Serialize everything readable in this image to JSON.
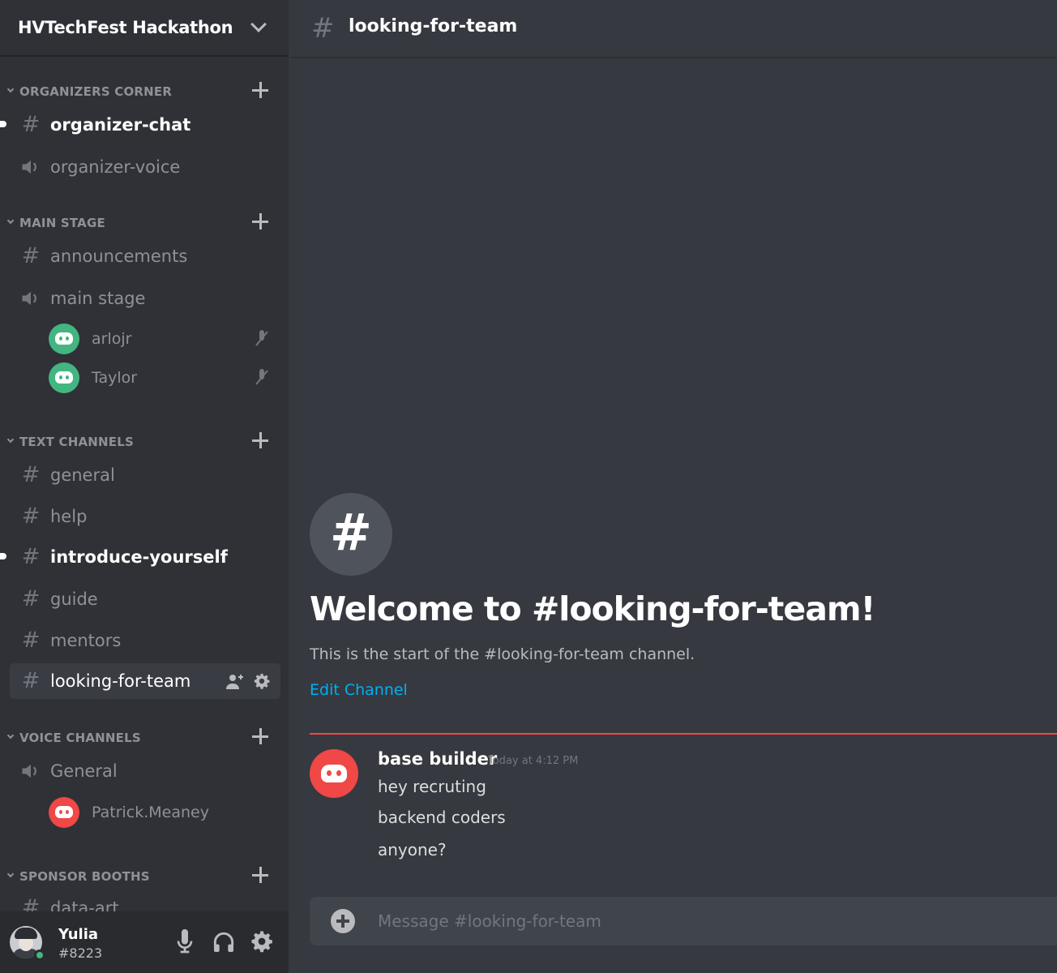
{
  "server": {
    "name": "HVTechFest Hackathon"
  },
  "categories": {
    "organizers": "ORGANIZERS CORNER",
    "main_stage": "MAIN STAGE",
    "text_channels": "TEXT CHANNELS",
    "voice_channels": "VOICE CHANNELS",
    "sponsor_booths": "SPONSOR BOOTHS"
  },
  "channels": {
    "organizer_chat": "organizer-chat",
    "organizer_voice": "organizer-voice",
    "announcements": "announcements",
    "main_stage": "main stage",
    "general": "general",
    "help": "help",
    "introduce_yourself": "introduce-yourself",
    "guide": "guide",
    "mentors": "mentors",
    "looking_for_team": "looking-for-team",
    "voice_general": "General",
    "data_art": "data-art"
  },
  "voice_users": {
    "main_stage": [
      "arlojr",
      "Taylor"
    ],
    "general": [
      "Patrick.Meaney"
    ]
  },
  "self": {
    "name": "Yulia",
    "tag": "#8223",
    "status": "online"
  },
  "header": {
    "channel": "looking-for-team"
  },
  "welcome": {
    "icon": "#",
    "title": "Welcome to #looking-for-team!",
    "subtitle": "This is the start of the #looking-for-team channel.",
    "edit_link": "Edit Channel"
  },
  "message": {
    "author": "base builder",
    "timestamp": "Today at 4:12 PM",
    "lines": [
      "hey recruting",
      "backend coders",
      "anyone?"
    ]
  },
  "composer": {
    "placeholder": "Message #looking-for-team"
  },
  "icons": {
    "text_channel": "hash-icon",
    "voice_channel": "speaker-icon",
    "mute": "mic-muted-icon",
    "invite": "add-member-icon",
    "settings": "gear-icon"
  },
  "colors": {
    "sidebar": "#2f3136",
    "main": "#36393f",
    "accent_link": "#00b0f4",
    "new_divider": "#f04747",
    "online": "#43b581"
  }
}
